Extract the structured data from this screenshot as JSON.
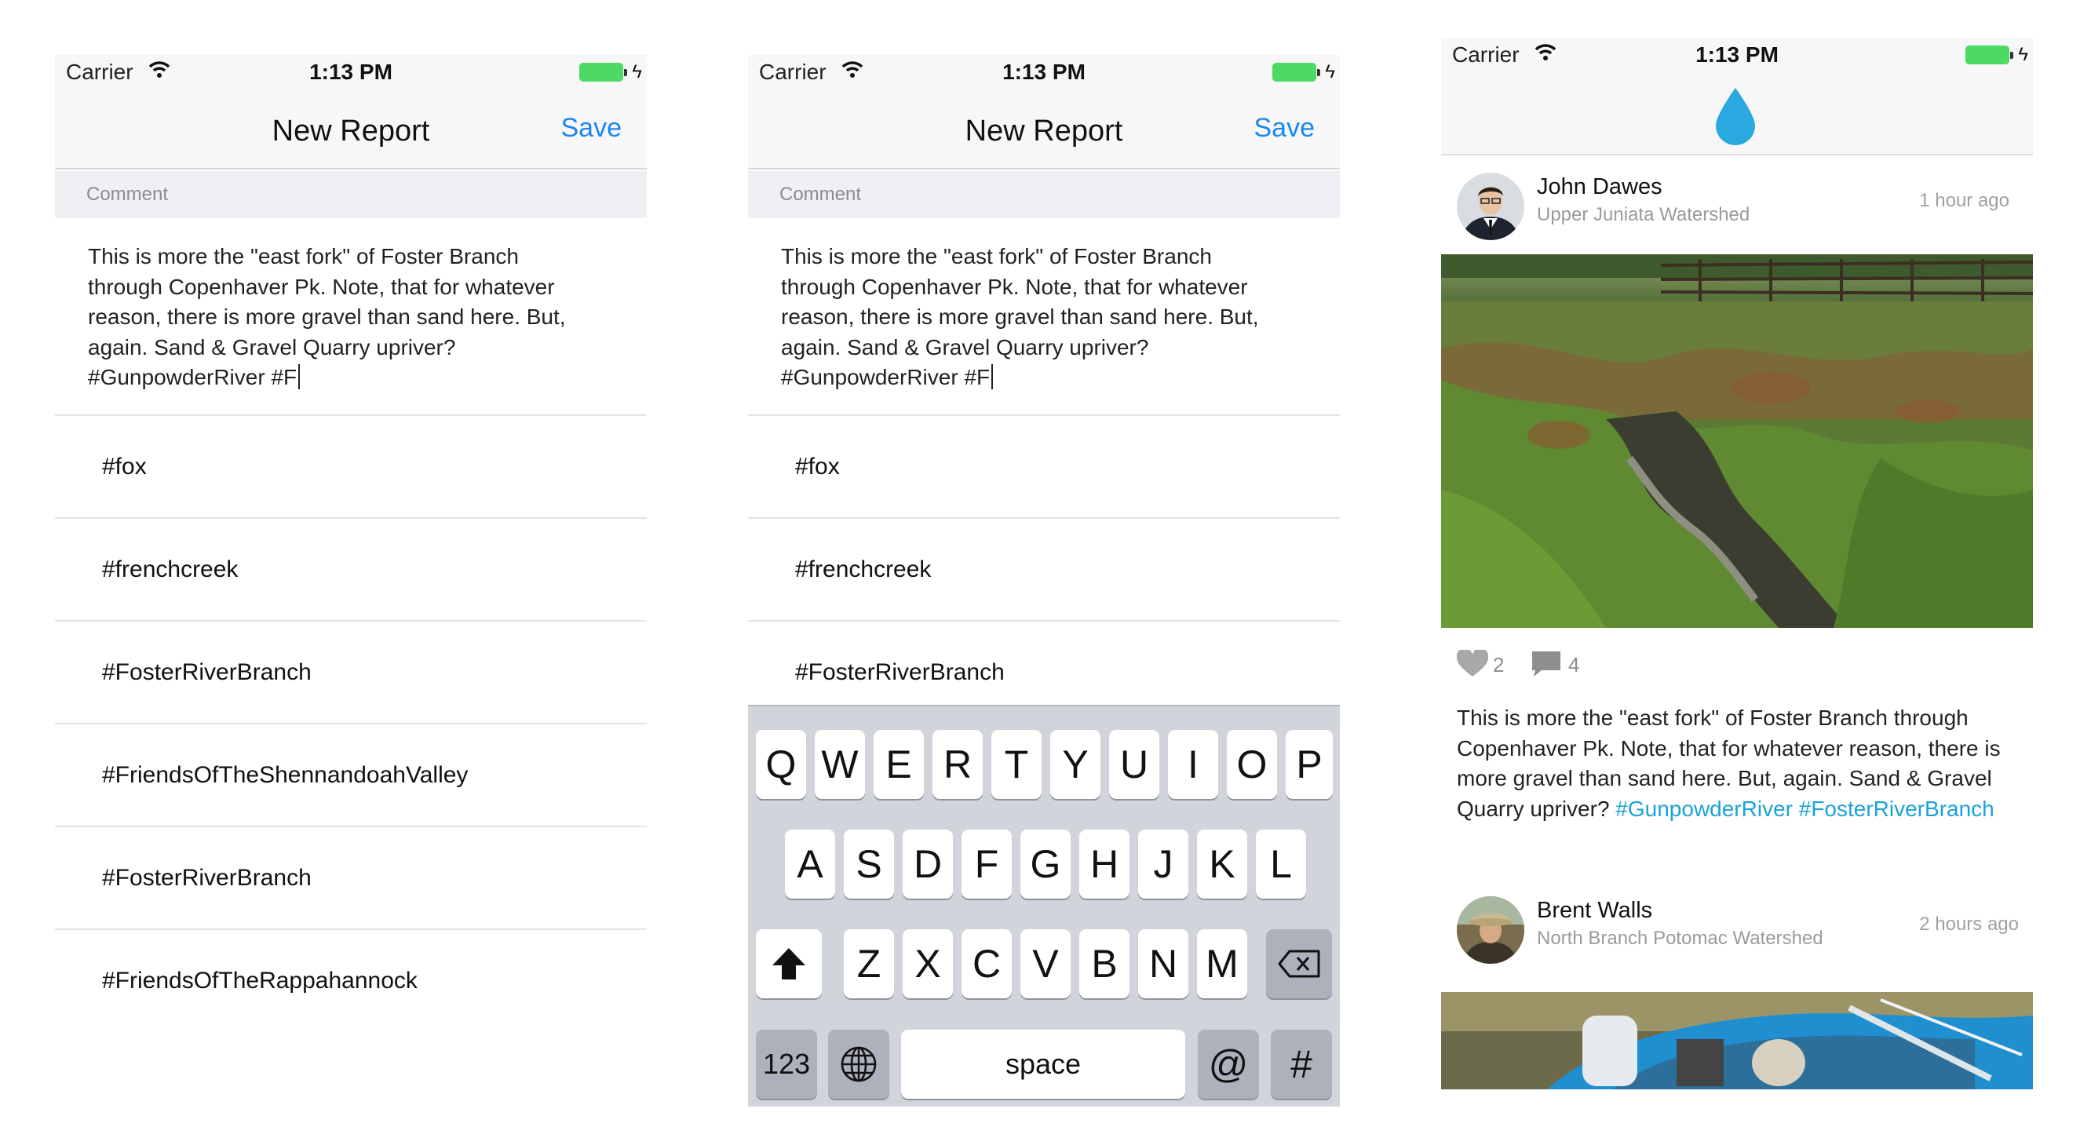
{
  "status": {
    "carrier": "Carrier",
    "time": "1:13 PM"
  },
  "report": {
    "title": "New Report",
    "save_label": "Save",
    "section_label": "Comment",
    "comment_text": "This is more the \"east fork\" of Foster Branch through Copenhaver Pk. Note, that for whatever reason, there is more gravel than sand here. But, again. Sand & Gravel Quarry upriver? #GunpowderRiver #F",
    "comment_lines": [
      "This is more the \"east fork\" of Foster Branch",
      "through Copenhaver Pk. Note, that for whatever",
      "reason, there is more gravel than sand here. But,",
      "again. Sand & Gravel Quarry upriver?",
      "#GunpowderRiver #F"
    ],
    "suggestions": [
      "#fox",
      "#frenchcreek",
      "#FosterRiverBranch",
      "#FriendsOfTheShennandoahValley",
      "#FosterRiverBranch",
      "#FriendsOfTheRappahannock"
    ]
  },
  "keyboard": {
    "row1": [
      "Q",
      "W",
      "E",
      "R",
      "T",
      "Y",
      "U",
      "I",
      "O",
      "P"
    ],
    "row2": [
      "A",
      "S",
      "D",
      "F",
      "G",
      "H",
      "J",
      "K",
      "L"
    ],
    "row3": [
      "Z",
      "X",
      "C",
      "V",
      "B",
      "N",
      "M"
    ],
    "numbers_label": "123",
    "space_label": "space",
    "at_label": "@",
    "hash_label": "#"
  },
  "feed": {
    "accent_color": "#29a9df",
    "posts": [
      {
        "author": "John Dawes",
        "watershed": "Upper Juniata Watershed",
        "time_ago": "1 hour ago",
        "likes": "2",
        "comments": "4",
        "caption_lines": [
          "This is more the \"east fork\" of Foster Branch through",
          "Copenhaver Pk. Note, that for whatever reason, there is",
          "more gravel than sand here. But, again. Sand & Gravel",
          "Quarry upriver? "
        ],
        "tags": [
          "#GunpowderRiver",
          "#FosterRiverBranch"
        ]
      },
      {
        "author": "Brent Walls",
        "watershed": "North Branch Potomac Watershed",
        "time_ago": "2 hours ago"
      }
    ]
  }
}
